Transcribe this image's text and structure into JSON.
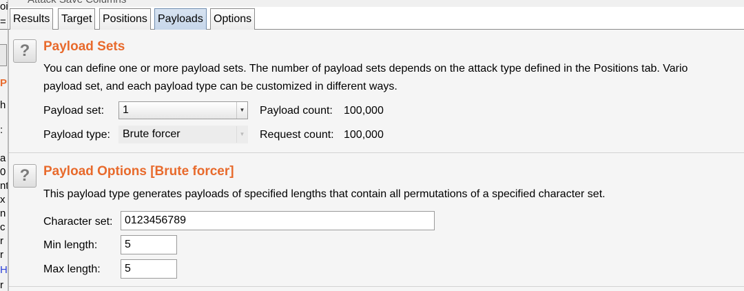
{
  "window": {
    "title": "Attack Save Columns"
  },
  "tabs": [
    {
      "label": "Results"
    },
    {
      "label": "Target"
    },
    {
      "label": "Positions"
    },
    {
      "label": "Payloads",
      "active": true
    },
    {
      "label": "Options"
    }
  ],
  "payload_sets": {
    "title": "Payload Sets",
    "description_line1": "You can define one or more payload sets. The number of payload sets depends on the attack type defined in the Positions tab. Vario",
    "description_line2": "payload set, and each payload type can be customized in different ways.",
    "payload_set_label": "Payload set:",
    "payload_set_value": "1",
    "payload_count_label": "Payload count:",
    "payload_count_value": "100,000",
    "payload_type_label": "Payload type:",
    "payload_type_value": "Brute forcer",
    "request_count_label": "Request count:",
    "request_count_value": "100,000"
  },
  "payload_options": {
    "title": "Payload Options [Brute forcer]",
    "description": "This payload type generates payloads of specified lengths that contain all permutations of a specified character set.",
    "character_set_label": "Character set:",
    "character_set_value": "0123456789",
    "min_length_label": "Min length:",
    "min_length_value": "5",
    "max_length_label": "Max length:",
    "max_length_value": "5"
  },
  "help_icon_glyph": "?",
  "icons": {
    "help": "help-icon",
    "dropdown": "chevron-down-icon"
  },
  "colors": {
    "section_title": "#e86a2c",
    "active_tab": "#c6d6ea"
  }
}
